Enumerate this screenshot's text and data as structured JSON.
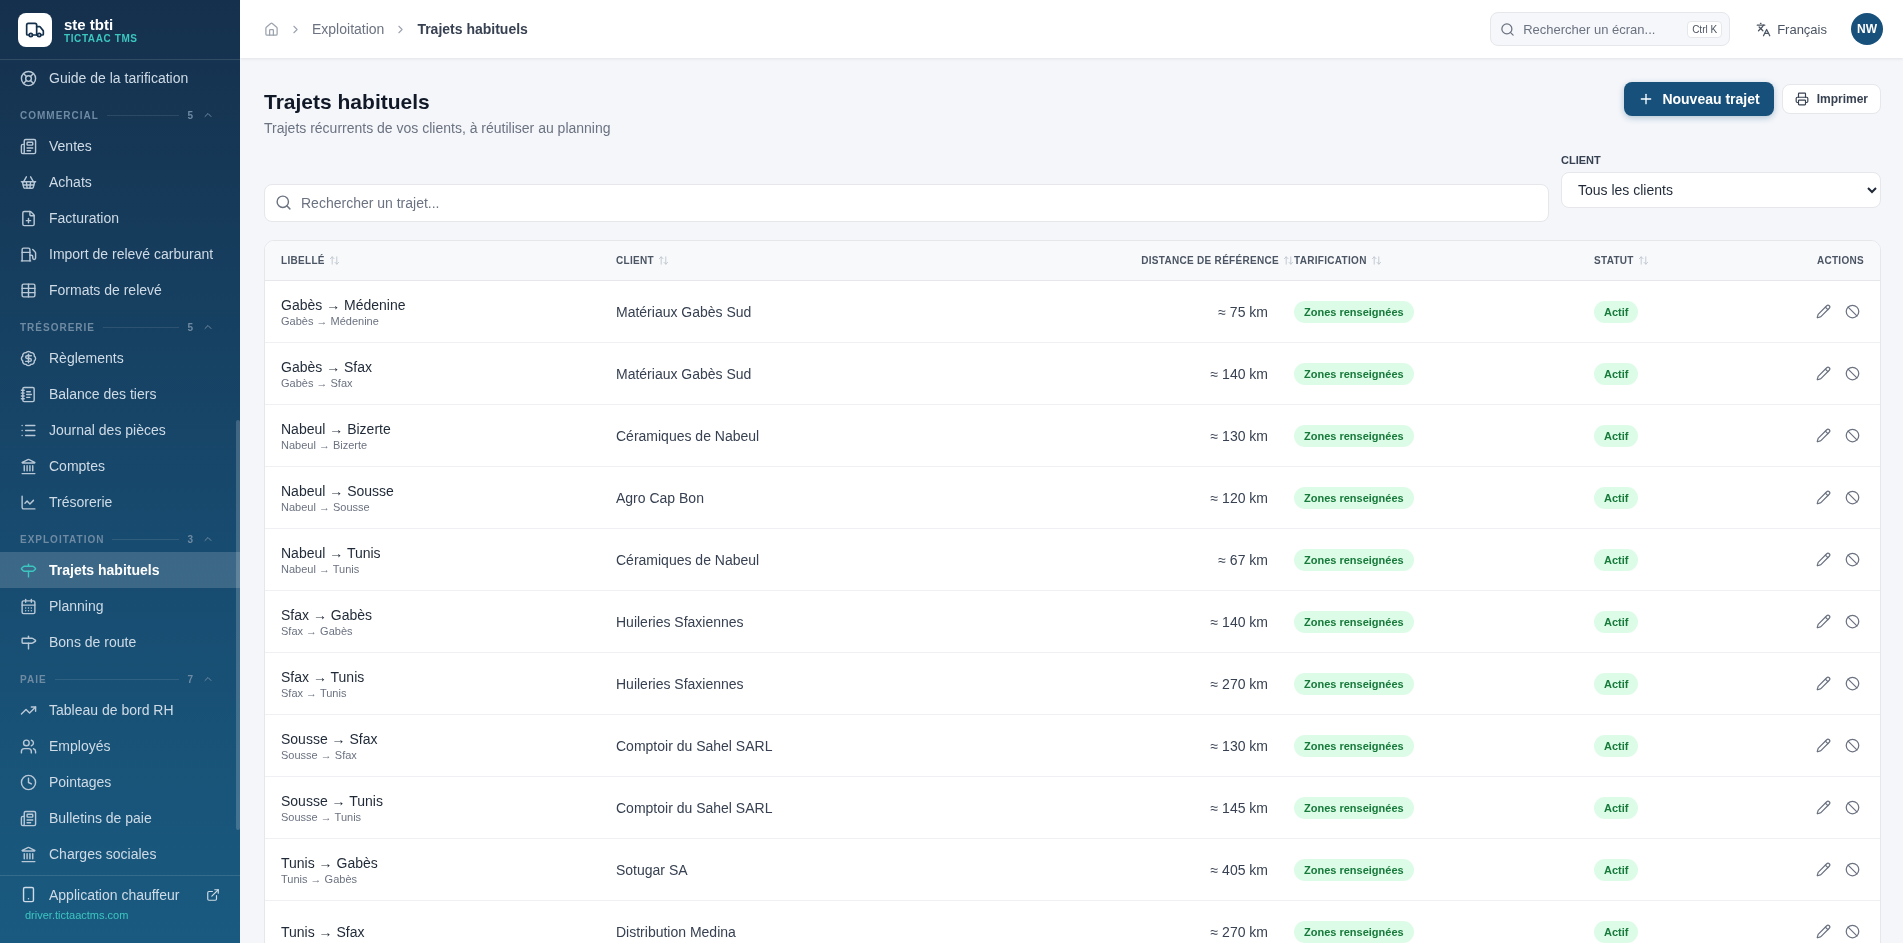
{
  "sidebar": {
    "brand": {
      "name": "ste tbti",
      "subtitle": "TICTAAC TMS"
    },
    "top_items": [
      {
        "label": "Guide de la tarification",
        "selected": false
      }
    ],
    "sections": [
      {
        "title": "COMMERCIAL",
        "count": "5",
        "expanded": true,
        "items": [
          {
            "label": "Ventes",
            "selected": false
          },
          {
            "label": "Achats",
            "selected": false
          },
          {
            "label": "Facturation",
            "selected": false
          },
          {
            "label": "Import de relevé carburant",
            "selected": false
          },
          {
            "label": "Formats de relevé",
            "selected": false
          }
        ]
      },
      {
        "title": "TRÉSORERIE",
        "count": "5",
        "expanded": true,
        "items": [
          {
            "label": "Règlements",
            "selected": false
          },
          {
            "label": "Balance des tiers",
            "selected": false
          },
          {
            "label": "Journal des pièces",
            "selected": false
          },
          {
            "label": "Comptes",
            "selected": false
          },
          {
            "label": "Trésorerie",
            "selected": false
          }
        ]
      },
      {
        "title": "EXPLOITATION",
        "count": "3",
        "expanded": true,
        "items": [
          {
            "label": "Trajets habituels",
            "selected": true
          },
          {
            "label": "Planning",
            "selected": false
          },
          {
            "label": "Bons de route",
            "selected": false
          }
        ]
      },
      {
        "title": "PAIE",
        "count": "7",
        "expanded": true,
        "items": [
          {
            "label": "Tableau de bord RH",
            "selected": false
          },
          {
            "label": "Employés",
            "selected": false
          },
          {
            "label": "Pointages",
            "selected": false
          },
          {
            "label": "Bulletins de paie",
            "selected": false
          },
          {
            "label": "Charges sociales",
            "selected": false
          }
        ]
      }
    ],
    "footer": {
      "label": "Application chauffeur",
      "url": "driver.tictaactms.com"
    }
  },
  "header": {
    "breadcrumbs": [
      "Exploitation",
      "Trajets habituels"
    ],
    "search": {
      "placeholder": "Rechercher un écran...",
      "shortcut": "Ctrl K"
    },
    "language": "Français",
    "avatar": "NW"
  },
  "page": {
    "title": "Trajets habituels",
    "subtitle": "Trajets récurrents de vos clients, à réutiliser au planning",
    "primary_button": "Nouveau trajet",
    "secondary_button": "Imprimer",
    "search": {
      "placeholder": "Rechercher un trajet..."
    },
    "filter": {
      "label": "CLIENT",
      "value": "Tous les clients"
    }
  },
  "table": {
    "columns": [
      {
        "label": "LIBELLÉ",
        "sortable": true
      },
      {
        "label": "CLIENT",
        "sortable": true
      },
      {
        "label": "DISTANCE DE RÉFÉRENCE",
        "sortable": true
      },
      {
        "label": "TARIFICATION",
        "sortable": true
      },
      {
        "label": "STATUT",
        "sortable": true
      },
      {
        "label": "ACTIONS",
        "sortable": false
      }
    ],
    "rows": [
      {
        "title": "Gabès → Médenine",
        "sub": "Gabès → Médenine",
        "client": "Matériaux Gabès Sud",
        "distance": "≈ 75 km",
        "pricing": "Zones renseignées",
        "status": "Actif"
      },
      {
        "title": "Gabès → Sfax",
        "sub": "Gabès → Sfax",
        "client": "Matériaux Gabès Sud",
        "distance": "≈ 140 km",
        "pricing": "Zones renseignées",
        "status": "Actif"
      },
      {
        "title": "Nabeul → Bizerte",
        "sub": "Nabeul → Bizerte",
        "client": "Céramiques de Nabeul",
        "distance": "≈ 130 km",
        "pricing": "Zones renseignées",
        "status": "Actif"
      },
      {
        "title": "Nabeul → Sousse",
        "sub": "Nabeul → Sousse",
        "client": "Agro Cap Bon",
        "distance": "≈ 120 km",
        "pricing": "Zones renseignées",
        "status": "Actif"
      },
      {
        "title": "Nabeul → Tunis",
        "sub": "Nabeul → Tunis",
        "client": "Céramiques de Nabeul",
        "distance": "≈ 67 km",
        "pricing": "Zones renseignées",
        "status": "Actif"
      },
      {
        "title": "Sfax → Gabès",
        "sub": "Sfax → Gabès",
        "client": "Huileries Sfaxiennes",
        "distance": "≈ 140 km",
        "pricing": "Zones renseignées",
        "status": "Actif"
      },
      {
        "title": "Sfax → Tunis",
        "sub": "Sfax → Tunis",
        "client": "Huileries Sfaxiennes",
        "distance": "≈ 270 km",
        "pricing": "Zones renseignées",
        "status": "Actif"
      },
      {
        "title": "Sousse → Sfax",
        "sub": "Sousse → Sfax",
        "client": "Comptoir du Sahel SARL",
        "distance": "≈ 130 km",
        "pricing": "Zones renseignées",
        "status": "Actif"
      },
      {
        "title": "Sousse → Tunis",
        "sub": "Sousse → Tunis",
        "client": "Comptoir du Sahel SARL",
        "distance": "≈ 145 km",
        "pricing": "Zones renseignées",
        "status": "Actif"
      },
      {
        "title": "Tunis → Gabès",
        "sub": "Tunis → Gabès",
        "client": "Sotugar SA",
        "distance": "≈ 405 km",
        "pricing": "Zones renseignées",
        "status": "Actif"
      },
      {
        "title": "Tunis → Sfax",
        "client": "Distribution Medina",
        "distance": "≈ 270 km",
        "pricing": "Zones renseignées",
        "status": "Actif"
      }
    ]
  }
}
